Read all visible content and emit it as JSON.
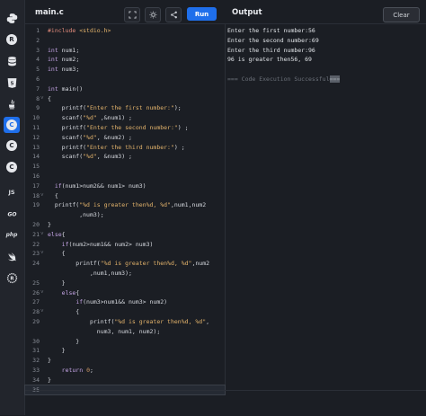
{
  "header": {
    "tab_name": "main.c",
    "run_label": "Run",
    "output_title": "Output",
    "clear_label": "Clear"
  },
  "sidebar": {
    "items": [
      {
        "icon": "python-icon",
        "label": ""
      },
      {
        "icon": "r-icon",
        "label": "R"
      },
      {
        "icon": "database-icon",
        "label": ""
      },
      {
        "icon": "html5-icon",
        "label": "5"
      },
      {
        "icon": "java-icon",
        "label": ""
      },
      {
        "icon": "c-icon",
        "label": "C",
        "active": true
      },
      {
        "icon": "cpp-icon",
        "label": "C"
      },
      {
        "icon": "csharp-icon",
        "label": "C"
      },
      {
        "icon": "javascript-icon",
        "label": "JS"
      },
      {
        "icon": "go-icon",
        "label": "GO"
      },
      {
        "icon": "php-icon",
        "label": "php"
      },
      {
        "icon": "swift-icon",
        "label": ""
      },
      {
        "icon": "rust-icon",
        "label": ""
      }
    ]
  },
  "editor": {
    "lines": [
      {
        "n": "1",
        "t": "#include <stdio.h>"
      },
      {
        "n": "2",
        "t": ""
      },
      {
        "n": "3",
        "t": "int num1;"
      },
      {
        "n": "4",
        "t": "int num2;"
      },
      {
        "n": "5",
        "t": "int num3;"
      },
      {
        "n": "6",
        "t": ""
      },
      {
        "n": "7",
        "t": "int main()"
      },
      {
        "n": "8",
        "t": "{",
        "fold": true
      },
      {
        "n": "9",
        "t": "    printf(\"Enter the first number:\");"
      },
      {
        "n": "10",
        "t": "    scanf(\"%d\" ,&num1) ;"
      },
      {
        "n": "11",
        "t": "    printf(\"Enter the second number:\") ;"
      },
      {
        "n": "12",
        "t": "    scanf(\"%d\", &num2) ;"
      },
      {
        "n": "13",
        "t": "    printf(\"Enter the third number:\") ;"
      },
      {
        "n": "14",
        "t": "    scanf(\"%d\", &num3) ;"
      },
      {
        "n": "15",
        "t": ""
      },
      {
        "n": "16",
        "t": ""
      },
      {
        "n": "17",
        "t": "  if(num1>num2&& num1> num3)"
      },
      {
        "n": "18",
        "t": "  {",
        "fold": true
      },
      {
        "n": "19",
        "t": "  printf(\"%d is greater then%d, %d\",num1,num2"
      },
      {
        "n": "",
        "t": "         ,num3);"
      },
      {
        "n": "20",
        "t": "}"
      },
      {
        "n": "21",
        "t": "else{",
        "fold": true
      },
      {
        "n": "22",
        "t": "    if(num2>num1&& num2> num3)"
      },
      {
        "n": "23",
        "t": "    {",
        "fold": true
      },
      {
        "n": "24",
        "t": "        printf(\"%d is greater then%d, %d\",num2"
      },
      {
        "n": "",
        "t": "            ,num1,num3);"
      },
      {
        "n": "25",
        "t": "    }"
      },
      {
        "n": "26",
        "t": "    else{",
        "fold": true
      },
      {
        "n": "27",
        "t": "        if(num3>num1&& num3> num2)"
      },
      {
        "n": "28",
        "t": "        {",
        "fold": true
      },
      {
        "n": "29",
        "t": "            printf(\"%d is greater then%d, %d\","
      },
      {
        "n": "",
        "t": "              num3, num1, num2);"
      },
      {
        "n": "30",
        "t": "        }"
      },
      {
        "n": "31",
        "t": "    }"
      },
      {
        "n": "32",
        "t": "}"
      },
      {
        "n": "33",
        "t": "    return 0;"
      },
      {
        "n": "34",
        "t": "}"
      },
      {
        "n": "35",
        "t": "",
        "current": true
      }
    ]
  },
  "output": {
    "lines": [
      "Enter the first number:56",
      "Enter the second number:69",
      "Enter the third number:96",
      "96 is greater then56, 69"
    ],
    "success": "=== Code Execution Successful",
    "success_tail": "==="
  },
  "colors": {
    "accent": "#1f6feb",
    "background": "#1b1e24"
  }
}
